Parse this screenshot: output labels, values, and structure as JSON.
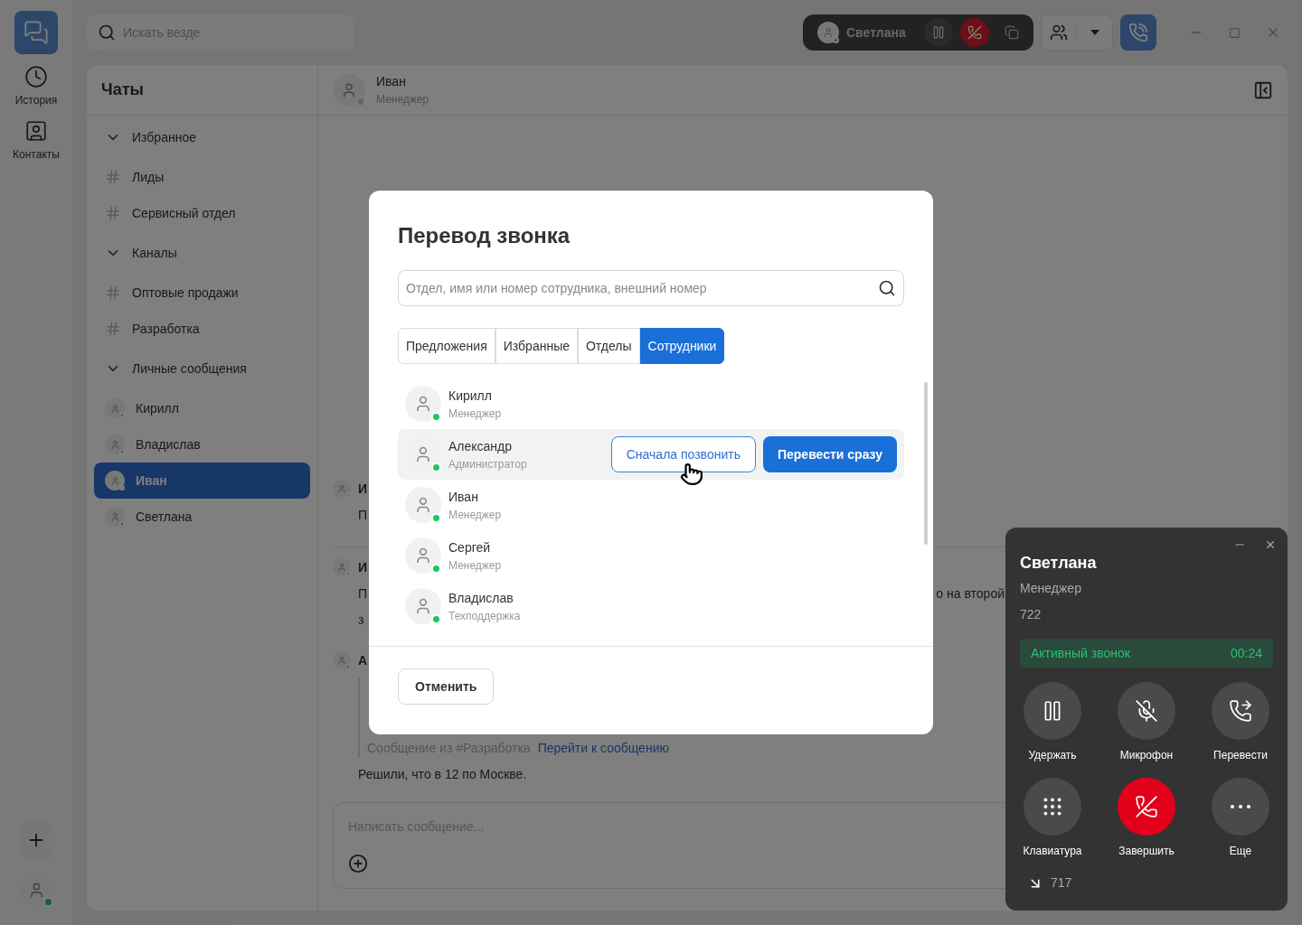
{
  "rail": {
    "items": [
      {
        "kind": "history",
        "label": "История"
      },
      {
        "kind": "contacts",
        "label": "Контакты"
      }
    ]
  },
  "search": {
    "placeholder": "Искать везде"
  },
  "active_call_pill": {
    "name": "Светлана",
    "online": true
  },
  "chats": {
    "title": "Чаты",
    "items": [
      {
        "kind": "section",
        "label": "Избранное",
        "expanded": true,
        "selected": false
      },
      {
        "kind": "channel",
        "label": "Лиды",
        "selected": false
      },
      {
        "kind": "channel",
        "label": "Сервисный отдел",
        "selected": false
      },
      {
        "kind": "section",
        "label": "Каналы",
        "expanded": true,
        "selected": false
      },
      {
        "kind": "channel",
        "label": "Оптовые продажи",
        "selected": false
      },
      {
        "kind": "channel",
        "label": "Разработка",
        "selected": false
      },
      {
        "kind": "section",
        "label": "Личные сообщения",
        "expanded": true,
        "selected": false
      },
      {
        "kind": "person",
        "label": "Кирилл",
        "online": true,
        "selected": false
      },
      {
        "kind": "person",
        "label": "Владислав",
        "online": true,
        "selected": false
      },
      {
        "kind": "person",
        "label": "Иван",
        "online": false,
        "selected": true
      },
      {
        "kind": "person",
        "label": "Светлана",
        "online": true,
        "selected": false
      }
    ]
  },
  "chat_header": {
    "name": "Иван",
    "role": "Менеджер",
    "online": false
  },
  "messages": [
    {
      "author": "И",
      "online": false,
      "lines": [
        {
          "start": "П"
        }
      ]
    },
    {
      "author": "И",
      "online": false,
      "lines": [
        {
          "start": "П",
          "end": "о на второй"
        },
        {
          "start": "з"
        }
      ]
    },
    {
      "author": "А",
      "online": true,
      "quote": {
        "source": "Сообщение из #Разработка",
        "link": "Перейти к сообщению"
      },
      "lines": [
        {
          "start": "Решили, что в 12 по Москве."
        }
      ]
    }
  ],
  "composer": {
    "placeholder": "Написать сообщение..."
  },
  "dialog": {
    "title": "Перевод звонка",
    "search_placeholder": "Отдел, имя или номер сотрудника, внешний номер",
    "tabs": [
      {
        "label": "Предложения",
        "selected": false
      },
      {
        "label": "Избранные",
        "selected": false
      },
      {
        "label": "Отделы",
        "selected": false
      },
      {
        "label": "Сотрудники",
        "selected": true
      }
    ],
    "contacts": [
      {
        "name": "Кирилл",
        "role": "Менеджер",
        "online": true,
        "highlighted": false
      },
      {
        "name": "Александр",
        "role": "Администратор",
        "online": true,
        "highlighted": true
      },
      {
        "name": "Иван",
        "role": "Менеджер",
        "online": true,
        "highlighted": false
      },
      {
        "name": "Сергей",
        "role": "Менеджер",
        "online": true,
        "highlighted": false
      },
      {
        "name": "Владислав",
        "role": "Техподдержка",
        "online": true,
        "highlighted": false
      }
    ],
    "actions": {
      "call_first": "Сначала позвонить",
      "transfer_now": "Перевести сразу"
    },
    "cancel": "Отменить"
  },
  "call_panel": {
    "name": "Светлана",
    "role": "Менеджер",
    "number": "722",
    "status": "Активный звонок",
    "timer": "00:24",
    "buttons": [
      {
        "kind": "hold",
        "label": "Удержать"
      },
      {
        "kind": "mic",
        "label": "Микрофон"
      },
      {
        "kind": "transfer",
        "label": "Перевести"
      },
      {
        "kind": "keypad",
        "label": "Клавиатура"
      },
      {
        "kind": "end",
        "label": "Завершить"
      },
      {
        "kind": "more",
        "label": "Еще"
      }
    ],
    "incoming": "717"
  }
}
